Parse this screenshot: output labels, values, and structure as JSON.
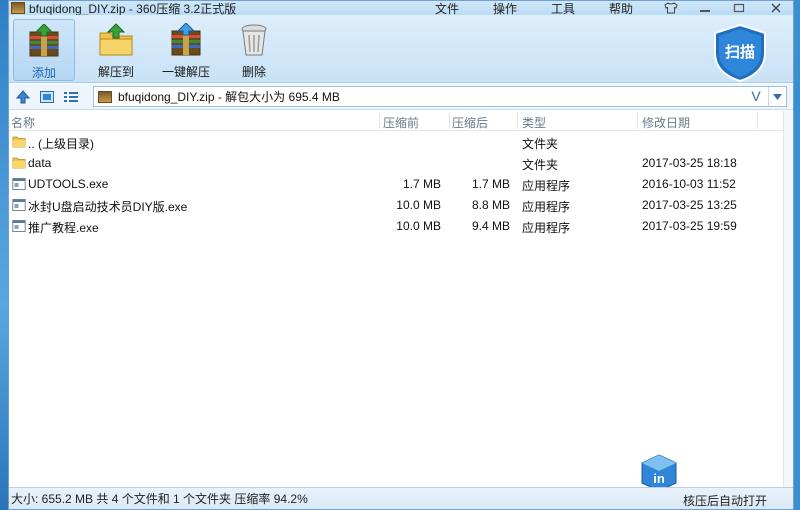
{
  "window": {
    "title": "bfuqidong_DIY.zip - 360压缩 3.2正式版",
    "menu": [
      "文件",
      "操作",
      "工具",
      "帮助"
    ]
  },
  "toolbar": {
    "add_label": "添加",
    "extract_to_label": "解压到",
    "one_click_label": "一键解压",
    "delete_label": "删除",
    "scan_label": "扫描"
  },
  "address": {
    "path": "bfuqidong_DIY.zip - 解包大小为 695.4 MB",
    "v_glyph": "V"
  },
  "columns": {
    "name": "名称",
    "compressed_before": "压缩前",
    "compressed_after": "压缩后",
    "type": "类型",
    "modified": "修改日期"
  },
  "files": [
    {
      "name": ".. (上级目录)",
      "before": "",
      "after": "",
      "type": "文件夹",
      "date": "",
      "icon": "folder-icon"
    },
    {
      "name": "data",
      "before": "",
      "after": "",
      "type": "文件夹",
      "date": "2017-03-25 18:18",
      "icon": "folder-icon"
    },
    {
      "name": "UDTOOLS.exe",
      "before": "1.7 MB",
      "after": "1.7 MB",
      "type": "应用程序",
      "date": "2016-10-03 11:52",
      "icon": "exe-icon"
    },
    {
      "name": "冰封U盘启动技术员DIY版.exe",
      "before": "10.0 MB",
      "after": "8.8 MB",
      "type": "应用程序",
      "date": "2017-03-25 13:25",
      "icon": "exe-icon"
    },
    {
      "name": "推广教程.exe",
      "before": "10.0 MB",
      "after": "9.4 MB",
      "type": "应用程序",
      "date": "2017-03-25 19:59",
      "icon": "exe-icon"
    }
  ],
  "status": {
    "summary": "大小: 655.2 MB 共 4 个文件和 1 个文件夹 压缩率 94.2%",
    "right": "核压后自动打开",
    "badge": "in"
  }
}
